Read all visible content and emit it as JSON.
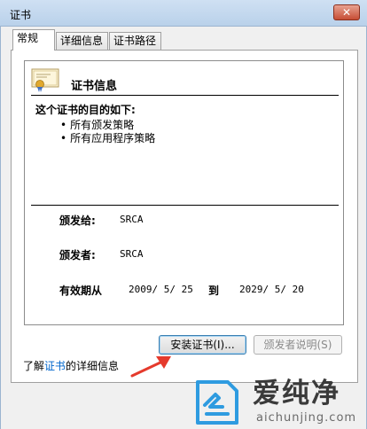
{
  "window": {
    "title": "证书",
    "close_label": "✕"
  },
  "tabs": [
    {
      "label": "常规",
      "active": true
    },
    {
      "label": "详细信息",
      "active": false
    },
    {
      "label": "证书路径",
      "active": false
    }
  ],
  "certificate": {
    "info_title": "证书信息",
    "purpose_heading": "这个证书的目的如下:",
    "purposes": [
      "所有颁发策略",
      "所有应用程序策略"
    ],
    "issued_to_label": "颁发给:",
    "issued_to_value": "SRCA",
    "issued_by_label": "颁发者:",
    "issued_by_value": "SRCA",
    "validity_label": "有效期从",
    "valid_from": "2009/  5/  25",
    "to_label": "到",
    "valid_to": "2029/  5/  20"
  },
  "buttons": {
    "install": "安装证书(I)...",
    "issuer_statement": "颁发者说明(S)"
  },
  "learn_more": {
    "prefix": "了解",
    "link": "证书",
    "suffix": "的详细信息"
  },
  "watermark": {
    "name": "爱纯净",
    "url": "aichunjing.com"
  },
  "colors": {
    "link": "#0066cc",
    "arrow": "#e53a2c",
    "titlebar": "#b9d1ea"
  }
}
